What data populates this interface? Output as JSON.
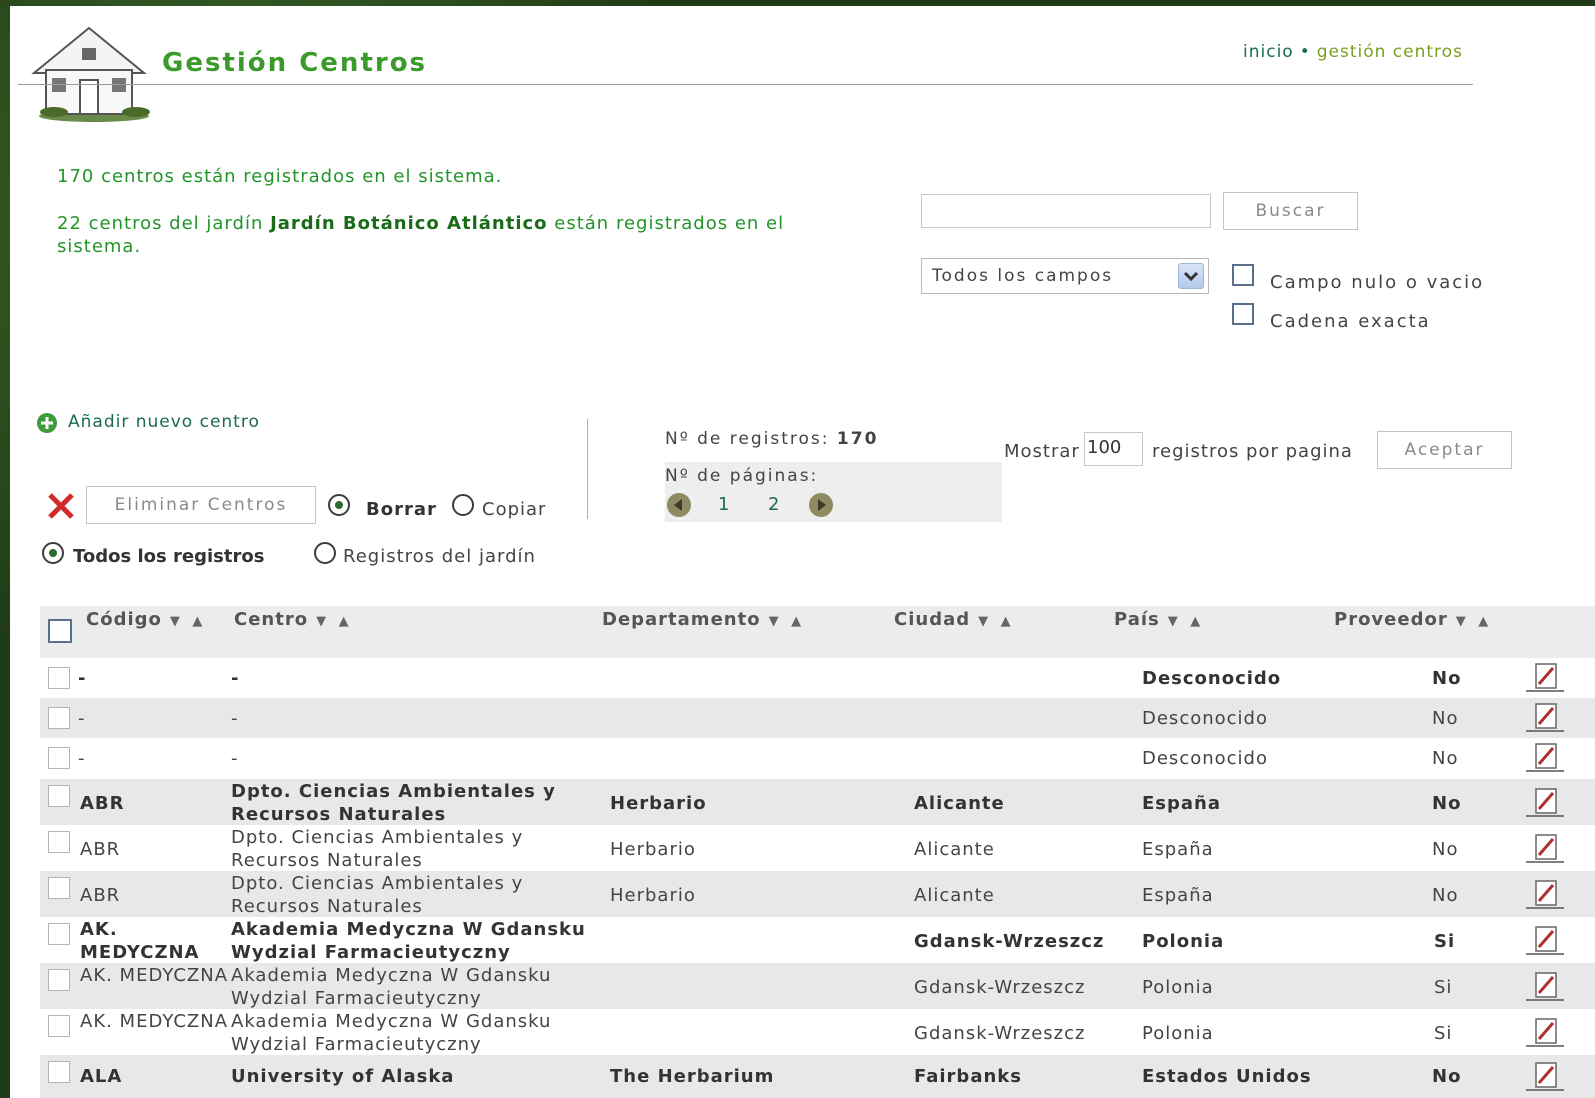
{
  "header": {
    "title": "Gestión Centros",
    "breadcrumb": {
      "home": "inicio",
      "separator": "•",
      "current": "gestión centros"
    }
  },
  "info": {
    "total_text": "170 centros están registrados en el sistema.",
    "garden_prefix": "22 centros del jardín ",
    "garden_name": "Jardín Botánico Atlántico",
    "garden_suffix": " están registrados en el sistema."
  },
  "search": {
    "value": "",
    "button": "Buscar",
    "field_select": "Todos los campos",
    "opt_null": "Campo nulo o vacio",
    "opt_exact": "Cadena exacta"
  },
  "actions": {
    "add_new": "Añadir nuevo centro",
    "delete_button": "Eliminar Centros",
    "mode_delete": "Borrar",
    "mode_copy": "Copiar",
    "filter_all": "Todos los registros",
    "filter_garden": "Registros del jardín"
  },
  "pagination": {
    "records_label": "Nº de registros:",
    "records_count": "170",
    "pages_label": "Nº de páginas:",
    "pages": [
      "1",
      "2"
    ],
    "show_label": "Mostrar",
    "show_value": "100",
    "per_page_label": "registros por pagina",
    "accept_button": "Aceptar"
  },
  "table": {
    "columns": [
      "Código",
      "Centro",
      "Departamento",
      "Ciudad",
      "País",
      "Proveedor"
    ],
    "sort_glyphs": "▼ ▲",
    "rows": [
      {
        "codigo": "-",
        "centro": "-",
        "departamento": "",
        "ciudad": "",
        "pais": "Desconocido",
        "proveedor": "No",
        "bold": true,
        "alt": false
      },
      {
        "codigo": "-",
        "centro": "-",
        "departamento": "",
        "ciudad": "",
        "pais": "Desconocido",
        "proveedor": "No",
        "bold": false,
        "alt": true
      },
      {
        "codigo": "-",
        "centro": "-",
        "departamento": "",
        "ciudad": "",
        "pais": "Desconocido",
        "proveedor": "No",
        "bold": false,
        "alt": false
      },
      {
        "codigo": "ABR",
        "centro": "Dpto. Ciencias Ambientales y Recursos Naturales",
        "departamento": "Herbario",
        "ciudad": "Alicante",
        "pais": "España",
        "proveedor": "No",
        "bold": true,
        "alt": true
      },
      {
        "codigo": "ABR",
        "centro": "Dpto. Ciencias Ambientales y Recursos Naturales",
        "departamento": "Herbario",
        "ciudad": "Alicante",
        "pais": "España",
        "proveedor": "No",
        "bold": false,
        "alt": false
      },
      {
        "codigo": "ABR",
        "centro": "Dpto. Ciencias Ambientales y Recursos Naturales",
        "departamento": "Herbario",
        "ciudad": "Alicante",
        "pais": "España",
        "proveedor": "No",
        "bold": false,
        "alt": true
      },
      {
        "codigo": "AK. MEDYCZNA",
        "centro": "Akademia Medyczna W Gdansku Wydzial Farmacieutyczny",
        "departamento": "",
        "ciudad": "Gdansk-Wrzeszcz",
        "pais": "Polonia",
        "proveedor": "Si",
        "bold": true,
        "alt": false
      },
      {
        "codigo": "AK. MEDYCZNA",
        "centro": "Akademia Medyczna W Gdansku Wydzial Farmacieutyczny",
        "departamento": "",
        "ciudad": "Gdansk-Wrzeszcz",
        "pais": "Polonia",
        "proveedor": "Si",
        "bold": false,
        "alt": true
      },
      {
        "codigo": "AK. MEDYCZNA",
        "centro": "Akademia Medyczna W Gdansku Wydzial Farmacieutyczny",
        "departamento": "",
        "ciudad": "Gdansk-Wrzeszcz",
        "pais": "Polonia",
        "proveedor": "Si",
        "bold": false,
        "alt": false
      },
      {
        "codigo": "ALA",
        "centro": "University of Alaska",
        "departamento": "The Herbarium",
        "ciudad": "Fairbanks",
        "pais": "Estados Unidos",
        "proveedor": "No",
        "bold": true,
        "alt": true
      }
    ]
  }
}
